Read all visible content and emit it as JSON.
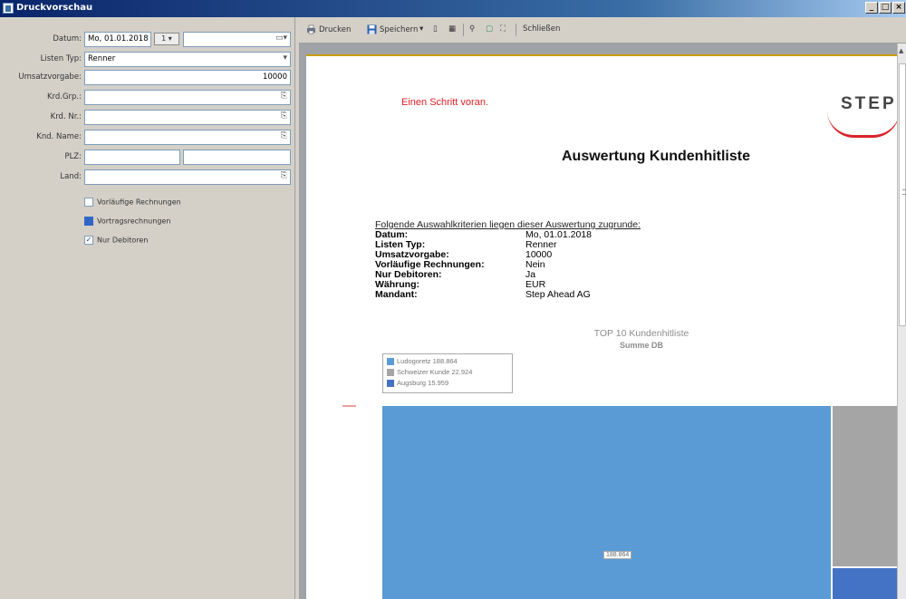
{
  "window": {
    "title": "Druckvorschau",
    "buttons": [
      "_",
      "□",
      "×"
    ]
  },
  "filters": {
    "datum_label": "Datum:",
    "datum_value": "Mo, 01.01.2018",
    "datum_spin": "1",
    "listen_typ_label": "Listen Typ:",
    "listen_typ_value": "Renner",
    "umsatzvorgabe_label": "Umsatzvorgabe:",
    "umsatzvorgabe_value": "10000",
    "krd_grp_label": "Krd.Grp.:",
    "krd_nr_label": "Krd. Nr.:",
    "knd_name_label": "Knd. Name:",
    "plz_label": "PLZ:",
    "land_label": "Land:",
    "vorlaeufige_label": "Vorläufige Rechnungen",
    "vorlaeufige_checked": false,
    "vortrag_label": "Vortragsrechnungen",
    "vortrag_checked": true,
    "nur_debitoren_label": "Nur Debitoren",
    "nur_debitoren_checked": true
  },
  "toolbar": {
    "drucken": "Drucken",
    "speichern": "Speichern",
    "schliessen": "Schließen"
  },
  "report": {
    "slogan": "Einen Schritt voran.",
    "logo": "STEP",
    "title": "Auswertung Kundenhitliste",
    "criteria_heading": "Folgende Auswahlkriterien liegen dieser Auswertung zugrunde:",
    "criteria": [
      {
        "key": "Datum:",
        "value": "Mo, 01.01.2018"
      },
      {
        "key": "Listen Typ:",
        "value": "Renner"
      },
      {
        "key": "Umsatzvorgabe:",
        "value": "10000"
      },
      {
        "key": "Vorläufige Rechnungen:",
        "value": "Nein"
      },
      {
        "key": "Nur Debitoren:",
        "value": "Ja"
      },
      {
        "key": "Währung:",
        "value": "EUR"
      },
      {
        "key": "Mandant:",
        "value": "Step Ahead AG"
      }
    ]
  },
  "chart_data": {
    "type": "bar",
    "title": "TOP 10 Kundenhitliste",
    "subtitle": "Summe DB",
    "legend_position": "top-left",
    "categories": [
      "Ludogoretz",
      "Schweizer Kunde",
      "Augsburg"
    ],
    "values": [
      188.864,
      22.924,
      15.959
    ],
    "legend_labels": [
      "Ludogoretz  188.864",
      "Schweizer Kunde  22.924",
      "Augsburg  15.959"
    ],
    "colors": [
      "#5b9bd5",
      "#a5a5a5",
      "#4472c4"
    ],
    "data_label": "188.864",
    "ylim": [
      0,
      200
    ]
  }
}
